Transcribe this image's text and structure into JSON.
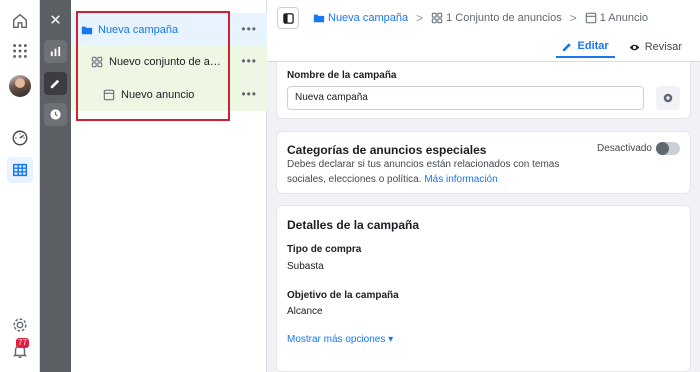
{
  "rail": {
    "icons": [
      "home-icon",
      "apps-grid-icon",
      "avatar",
      "dashboard-gauge-icon",
      "ads-manager-table-icon",
      "settings-gear-icon",
      "notifications-bell-icon"
    ],
    "notification_count": "77"
  },
  "tools": [
    "close-icon",
    "bar-chart-icon",
    "pencil-icon",
    "clock-icon"
  ],
  "tree": {
    "campaign_label": "Nueva campaña",
    "adset_label": "Nuevo conjunto de anuncios",
    "ad_label": "Nuevo anuncio",
    "more_label": "•••"
  },
  "breadcrumb": {
    "campaign": "Nueva campaña",
    "adset": "1 Conjunto de anuncios",
    "ad": "1 Anuncio",
    "separator": ">"
  },
  "tabs": {
    "edit": "Editar",
    "review": "Revisar"
  },
  "campaign_name": {
    "label": "Nombre de la campaña",
    "value": "Nueva campaña"
  },
  "special_categories": {
    "title": "Categorías de anuncios especiales",
    "description": "Debes declarar si tus anuncios están relacionados con temas sociales, elecciones o política.",
    "link": "Más información",
    "status": "Desactivado",
    "enabled": false
  },
  "details": {
    "title": "Detalles de la campaña",
    "buy_type_label": "Tipo de compra",
    "buy_type_value": "Subasta",
    "objective_label": "Objetivo de la campaña",
    "objective_value": "Alcance",
    "more_options": "Mostrar más opciones ▾"
  },
  "colors": {
    "accent": "#1877f2",
    "highlight_box": "#d0222e",
    "tool_column": "#5c5f63"
  }
}
